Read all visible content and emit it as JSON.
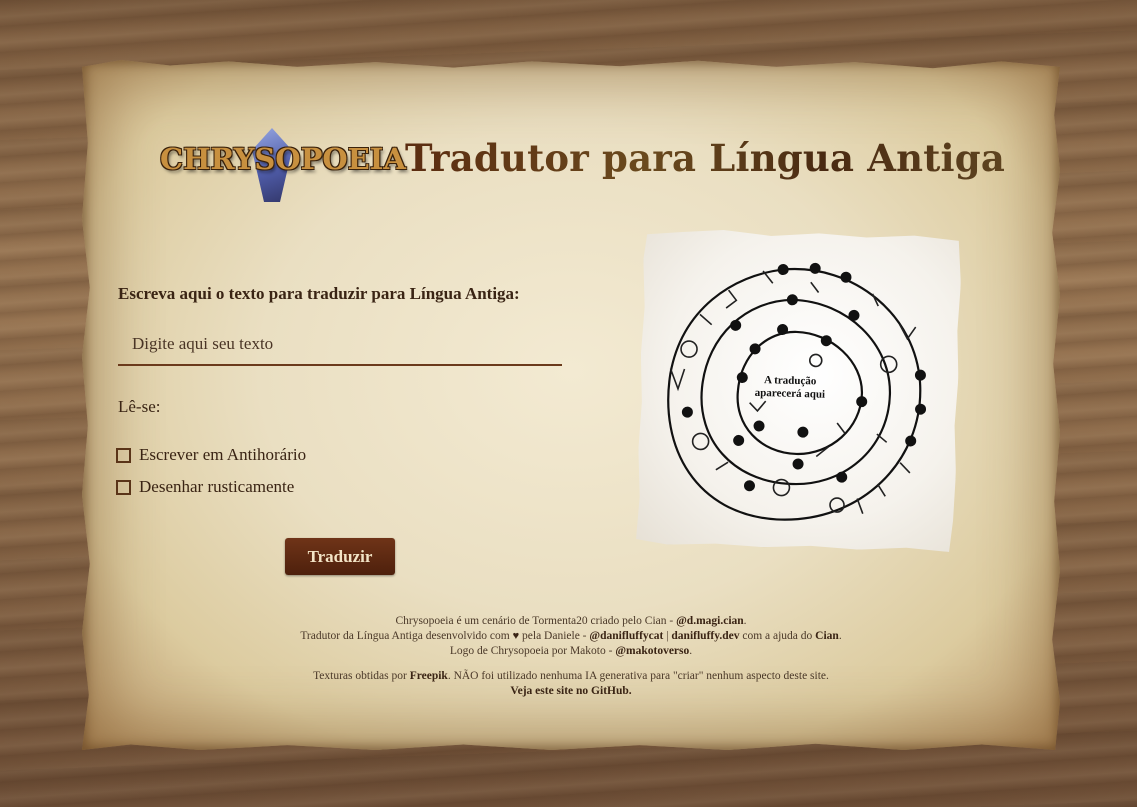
{
  "logo": {
    "text": "CHRYSOPOEIA"
  },
  "header": {
    "title": "Tradutor para Língua Antiga"
  },
  "form": {
    "prompt": "Escreva aqui o texto para traduzir para Língua Antiga:",
    "input_placeholder": "Digite aqui seu texto",
    "input_value": "",
    "reading_label": "Lê-se:",
    "options": [
      {
        "label": "Escrever em Antihorário",
        "checked": false
      },
      {
        "label": "Desenhar rusticamente",
        "checked": false
      }
    ],
    "submit_label": "Traduzir"
  },
  "preview": {
    "placeholder_line1": "A tradução",
    "placeholder_line2": "aparecerá aqui"
  },
  "footer": {
    "line1_pre": "Chrysopoeia é um cenário de Tormenta20 criado pelo Cian - ",
    "line1_link": "@d.magi.cian",
    "line1_post": ".",
    "line2_pre": "Tradutor da Língua Antiga desenvolvido com ",
    "line2_mid": " pela Daniele - ",
    "line2_link1": "@danifluffycat",
    "line2_sep": " | ",
    "line2_link2": "danifluffy.dev",
    "line2_mid2": " com a ajuda do ",
    "line2_link3": "Cian",
    "line2_post": ".",
    "line3_pre": "Logo de Chrysopoeia por Makoto - ",
    "line3_link": "@makotoverso",
    "line3_post": ".",
    "line4_pre": "Texturas obtidas por ",
    "line4_link": "Freepik",
    "line4_post": ". NÃO foi utilizado nenhuma IA generativa para \"criar\" nenhum aspecto deste site.",
    "line5_link": "Veja este site no GitHub."
  },
  "colors": {
    "accent": "#5a3418",
    "button": "#5e2a12",
    "parchment": "#eadfc2"
  }
}
